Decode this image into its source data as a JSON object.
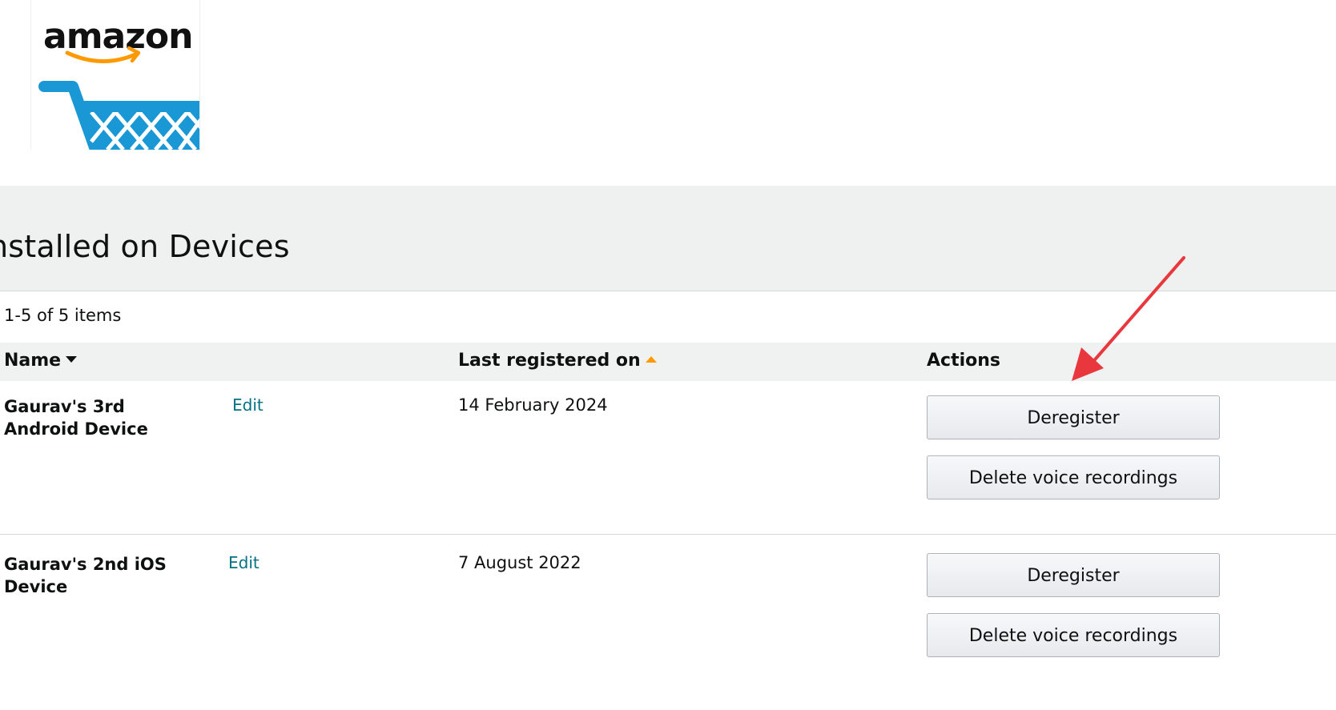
{
  "logo": {
    "brand": "amazon",
    "icon": "shopping-cart-icon",
    "brand_color": "#ff9900",
    "cart_color": "#1a98d5"
  },
  "page": {
    "title": "nstalled on Devices",
    "item_count": "1-5 of 5 items"
  },
  "table": {
    "columns": {
      "name": "Name",
      "last_registered": "Last registered on",
      "actions": "Actions"
    },
    "rows": [
      {
        "name": "Gaurav's 3rd Android Device",
        "edit": "Edit",
        "date": "14 February 2024",
        "deregister": "Deregister",
        "delete_voice": "Delete voice recordings"
      },
      {
        "name": "Gaurav's 2nd iOS Device",
        "edit": "Edit",
        "date": "7 August 2022",
        "deregister": "Deregister",
        "delete_voice": "Delete voice recordings"
      }
    ]
  },
  "colors": {
    "link": "#007185",
    "header_band": "#eff1f1",
    "annotation": "#e8383d"
  }
}
